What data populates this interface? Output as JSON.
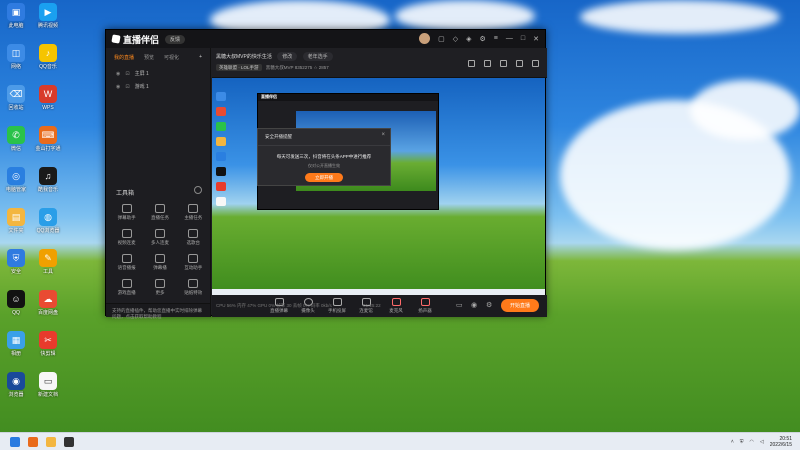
{
  "desktop": {
    "icons": [
      {
        "label": "此电脑",
        "color": "#2f7be0",
        "glyph": "▣"
      },
      {
        "label": "腾讯视频",
        "color": "#1aa0f0",
        "glyph": "▶"
      },
      {
        "label": "网络",
        "color": "#3c8be6",
        "glyph": "◫"
      },
      {
        "label": "QQ音乐",
        "color": "#f5c400",
        "glyph": "♪"
      },
      {
        "label": "回收站",
        "color": "#4d9be8",
        "glyph": "⌫"
      },
      {
        "label": "WPS",
        "color": "#d83b2a",
        "glyph": "W"
      },
      {
        "label": "微信",
        "color": "#2ac24a",
        "glyph": "✆"
      },
      {
        "label": "金山打字通",
        "color": "#e96b1c",
        "glyph": "⌨"
      },
      {
        "label": "电脑管家",
        "color": "#2a7fe0",
        "glyph": "◎"
      },
      {
        "label": "酷我音乐",
        "color": "#1a1a1a",
        "glyph": "♫"
      },
      {
        "label": "文件夹",
        "color": "#f3b640",
        "glyph": "▤"
      },
      {
        "label": "QQ浏览器",
        "color": "#2a9ee8",
        "glyph": "◍"
      },
      {
        "label": "安全",
        "color": "#2f7be0",
        "glyph": "⛨"
      },
      {
        "label": "工具",
        "color": "#f0a000",
        "glyph": "✎"
      },
      {
        "label": "QQ",
        "color": "#121212",
        "glyph": "☺"
      },
      {
        "label": "百度网盘",
        "color": "#e94b32",
        "glyph": "☁"
      },
      {
        "label": "相册",
        "color": "#3aa0e8",
        "glyph": "▦"
      },
      {
        "label": "快剪辑",
        "color": "#e83b2c",
        "glyph": "✂"
      },
      {
        "label": "浏览器",
        "color": "#1a4a9a",
        "glyph": "◉"
      },
      {
        "label": "新建文档",
        "color": "#f7f7f7",
        "glyph": "▭"
      }
    ]
  },
  "app": {
    "logo": "直播伴侣",
    "version_badge": "反馈",
    "room_title": "黑糖大叔MVP的快乐生活",
    "edit_pill": "修改",
    "category_pill": "老年选手",
    "meta_tag": "英雄联盟 · LOL手游",
    "meta_text": "黑糖大叔MVP   8352275   ☆ 2857",
    "side_tabs": [
      "我的直播",
      "预览",
      "可视化"
    ],
    "scenes": [
      {
        "name": "主屏 1"
      },
      {
        "name": "游戏 1"
      }
    ],
    "tools_title": "工具箱",
    "tools": [
      "弹幕助手",
      "直播任务",
      "主播任务",
      "视频连麦",
      "多人连麦",
      "选歌台",
      "语音播报",
      "弹幕播",
      "互动助手",
      "游戏直播",
      "更多",
      "贴纸特效"
    ],
    "notice": "支持的直播插件，帮助您直播中实时排除弹幕问题，点击获取帮助教程",
    "dialog": {
      "title": "安全开播提醒",
      "message": "每天可发送三次，抖音将在头条APP中进行推荐",
      "sub": "仅对公开直播生效",
      "button": "立即开播"
    },
    "controls": [
      "直播弹幕",
      "摄像头",
      "手机投屏",
      "连麦馆",
      "麦克风",
      "扬声器"
    ],
    "go_live": "开始直播",
    "status_line": "CPU 56%    内存 47%    GPU 0%    帧率 30    丢帧 0%    码率 0kb/s",
    "timer": "01:25:22"
  },
  "taskbar": {
    "time": "20:51",
    "date": "2022/6/15"
  }
}
